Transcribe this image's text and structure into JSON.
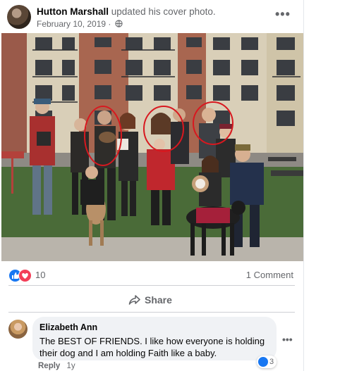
{
  "post": {
    "author": "Hutton Marshall",
    "action": "updated his cover photo.",
    "date": "February 10, 2019 ·",
    "more": "•••",
    "privacy_icon": "globe-icon"
  },
  "reactions": {
    "types": [
      "like",
      "love"
    ],
    "count": "10",
    "comments_label": "1 Comment"
  },
  "actions": {
    "share_label": "Share"
  },
  "comment": {
    "author": "Elizabeth Ann",
    "text": "The BEST OF FRIENDS. I like how everyone is holding their dog and I am holding Faith like a baby.",
    "reaction_count": "3",
    "reply_label": "Reply",
    "time": "1y",
    "more": "•••"
  },
  "colors": {
    "like_blue": "#1877f2",
    "love_red": "#f33e58",
    "secondary_text": "#65676b",
    "bubble_bg": "#f0f2f5",
    "circle_annotation": "#d8181f"
  }
}
